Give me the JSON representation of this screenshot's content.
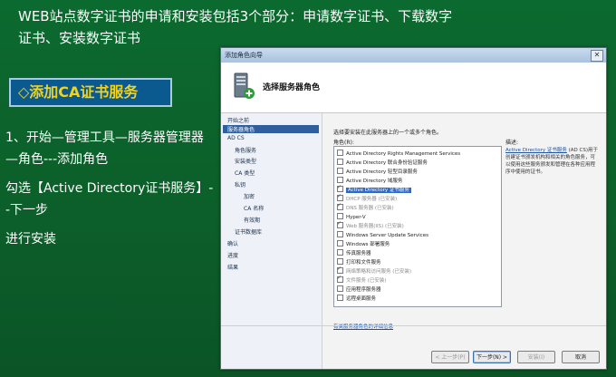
{
  "slide": {
    "title_lines": [
      "WEB站点数字证书的申请和安装包括3个部分：申请数字证书、下载数字",
      "证书、安装数字证书"
    ],
    "banner": "◇添加CA证书服务",
    "steps": [
      "1、开始—管理工具—服务器管理器—角色---添加角色",
      "勾选【Active Directory证书服务】--下一步",
      "进行安装"
    ]
  },
  "window": {
    "title": "添加角色向导",
    "close": "✕",
    "header_title": "选择服务器角色",
    "nav": [
      "开始之前",
      "服务器角色",
      "AD CS",
      "角色服务",
      "安装类型",
      "CA 类型",
      "私钥",
      "加密",
      "CA 名称",
      "有效期",
      "证书数据库",
      "确认",
      "进度",
      "结果"
    ],
    "instruction": "选择要安装在此服务器上的一个或多个角色。",
    "roles_label": "角色(R):",
    "roles": [
      {
        "label": "Active Directory Rights Management Services",
        "checked": false,
        "disabled": false,
        "selected": false
      },
      {
        "label": "Active Directory 联合身份验证服务",
        "checked": false,
        "disabled": false,
        "selected": false
      },
      {
        "label": "Active Directory 轻型目录服务",
        "checked": false,
        "disabled": false,
        "selected": false
      },
      {
        "label": "Active Directory 域服务",
        "checked": false,
        "disabled": false,
        "selected": false
      },
      {
        "label": "Active Directory 证书服务",
        "checked": true,
        "disabled": false,
        "selected": true
      },
      {
        "label": "DHCP 服务器  (已安装)",
        "checked": true,
        "disabled": true,
        "selected": false
      },
      {
        "label": "DNS 服务器  (已安装)",
        "checked": true,
        "disabled": true,
        "selected": false
      },
      {
        "label": "Hyper-V",
        "checked": false,
        "disabled": false,
        "selected": false
      },
      {
        "label": "Web 服务器(IIS)  (已安装)",
        "checked": true,
        "disabled": true,
        "selected": false
      },
      {
        "label": "Windows Server Update Services",
        "checked": false,
        "disabled": false,
        "selected": false
      },
      {
        "label": "Windows 部署服务",
        "checked": false,
        "disabled": false,
        "selected": false
      },
      {
        "label": "传真服务器",
        "checked": false,
        "disabled": false,
        "selected": false
      },
      {
        "label": "打印和文件服务",
        "checked": false,
        "disabled": false,
        "selected": false
      },
      {
        "label": "网络策略和访问服务  (已安装)",
        "checked": true,
        "disabled": true,
        "selected": false
      },
      {
        "label": "文件服务  (已安装)",
        "checked": true,
        "disabled": true,
        "selected": false
      },
      {
        "label": "应用程序服务器",
        "checked": false,
        "disabled": false,
        "selected": false
      },
      {
        "label": "远程桌面服务",
        "checked": false,
        "disabled": false,
        "selected": false
      }
    ],
    "description_label": "描述:",
    "description_link": "Active Directory 证书服务",
    "description_text": "(AD CS)用于创建证书颁发机构和相关的角色服务，可以使用这些服务颁发和管理在各种应用程序中使用的证书。",
    "more_link": "有关服务器角色的详细信息",
    "buttons": {
      "prev": "< 上一步(P)",
      "next": "下一步(N) >",
      "install": "安装(I)",
      "cancel": "取消"
    }
  }
}
